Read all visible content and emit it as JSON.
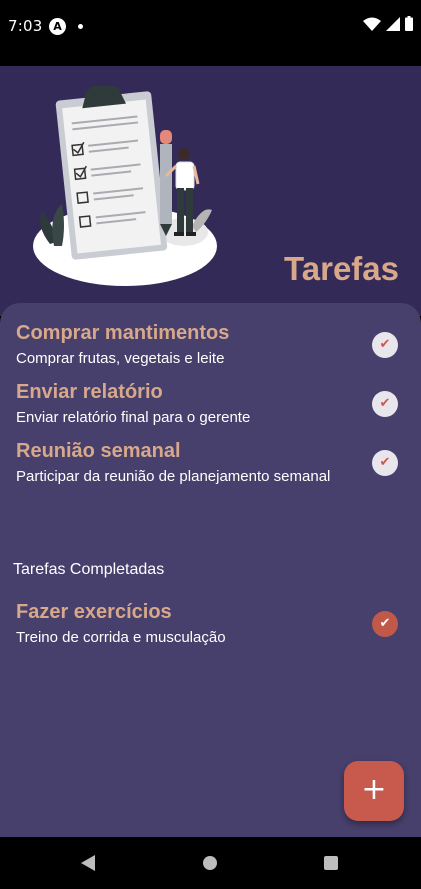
{
  "status_bar": {
    "time": "7:03",
    "app_icon_letter": "A"
  },
  "header": {
    "title": "Tarefas"
  },
  "pending_tasks": [
    {
      "title": "Comprar mantimentos",
      "description": "Comprar frutas, vegetais e leite",
      "completed": false
    },
    {
      "title": "Enviar relatório",
      "description": "Enviar relatório final para o gerente",
      "completed": false
    },
    {
      "title": "Reunião semanal",
      "description": "Participar da reunião de planejamento semanal",
      "completed": false
    }
  ],
  "completed_section": {
    "heading": "Tarefas Completadas",
    "tasks": [
      {
        "title": "Fazer exercícios",
        "description": "Treino de corrida e musculação",
        "completed": true
      }
    ]
  },
  "fab": {
    "label": "+"
  },
  "icons": {
    "check": "check-icon",
    "add": "plus-icon",
    "back": "back-triangle-icon",
    "home": "home-circle-icon",
    "recent": "recent-square-icon"
  },
  "colors": {
    "header_bg": "#342a58",
    "content_bg": "#473f6c",
    "accent_text": "#d8a88a",
    "fab_bg": "#c75a4c",
    "done_check_bg": "#c0594a"
  }
}
